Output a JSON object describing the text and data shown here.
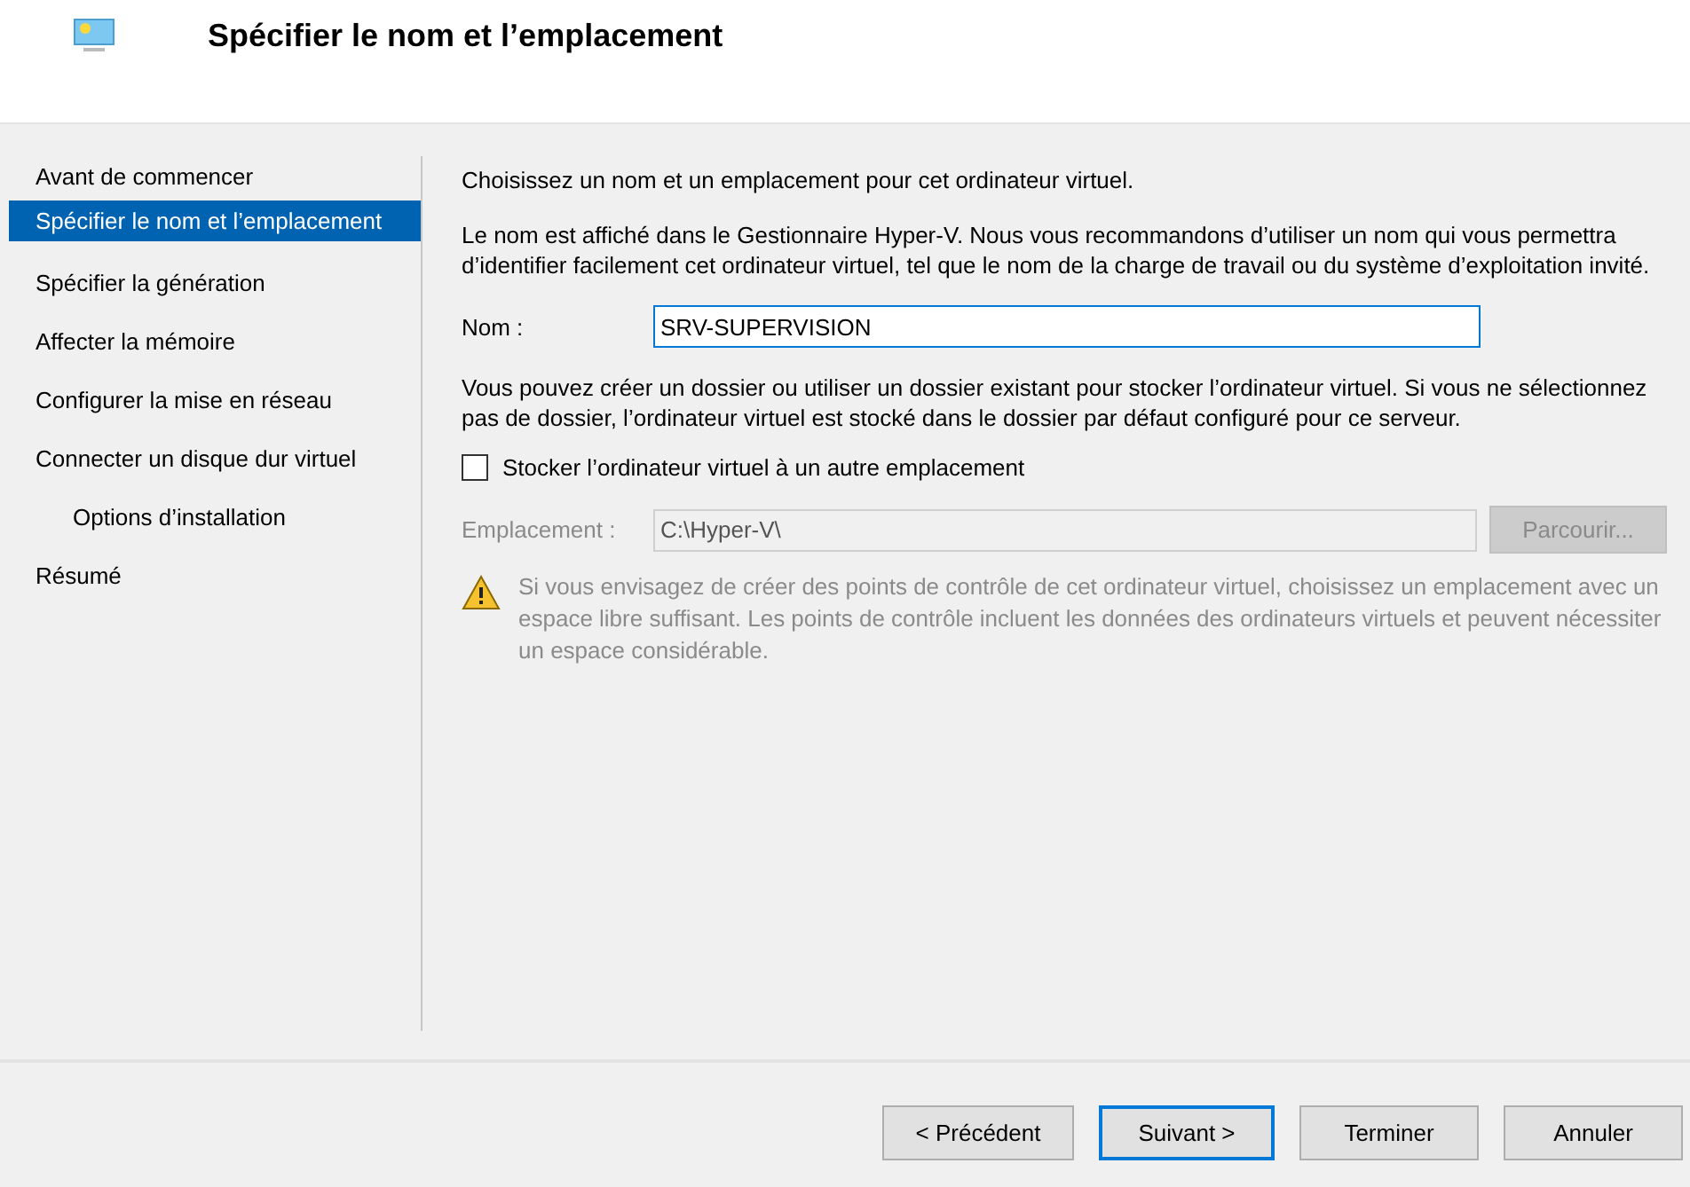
{
  "header": {
    "title": "Spécifier le nom et l’emplacement"
  },
  "steps": [
    {
      "label": "Avant de commencer",
      "selected": false
    },
    {
      "label": "Spécifier le nom et l’emplacement",
      "selected": true
    },
    {
      "label": "Spécifier la génération",
      "selected": false
    },
    {
      "label": "Affecter la mémoire",
      "selected": false
    },
    {
      "label": "Configurer la mise en réseau",
      "selected": false
    },
    {
      "label": "Connecter un disque dur virtuel",
      "selected": false,
      "children": [
        {
          "label": "Options d’installation",
          "selected": false
        }
      ]
    },
    {
      "label": "Résumé",
      "selected": false
    }
  ],
  "content": {
    "intro": "Choisissez un nom et un emplacement pour cet ordinateur virtuel.",
    "description": "Le nom est affiché dans le Gestionnaire Hyper-V. Nous vous recommandons d’utiliser un nom qui vous permettra d’identifier facilement cet ordinateur virtuel, tel que le nom de la charge de travail ou du système d’exploitation invité.",
    "name_field": {
      "label": "Nom :",
      "value": "SRV-SUPERVISION"
    },
    "folder_text": "Vous pouvez créer un dossier ou utiliser un dossier existant pour stocker l’ordinateur virtuel. Si vous ne sélectionnez pas de dossier, l’ordinateur virtuel est stocké dans le dossier par défaut configuré pour ce serveur.",
    "checkbox": {
      "label": "Stocker l’ordinateur virtuel à un autre emplacement",
      "checked": false
    },
    "location_field": {
      "label": "Emplacement :",
      "value": "C:\\Hyper-V\\",
      "disabled": true
    },
    "browse_button": {
      "label": "Parcourir...",
      "disabled": true
    },
    "warning": "Si vous envisagez de créer des points de contrôle de cet ordinateur virtuel, choisissez un emplacement avec un espace libre suffisant. Les points de contrôle incluent les données des ordinateurs virtuels et peuvent nécessiter un espace considérable."
  },
  "buttons": [
    {
      "label": "< Précédent",
      "focused": false
    },
    {
      "label": "Suivant >",
      "focused": true
    },
    {
      "label": "Terminer",
      "focused": false
    },
    {
      "label": "Annuler",
      "focused": false
    }
  ]
}
